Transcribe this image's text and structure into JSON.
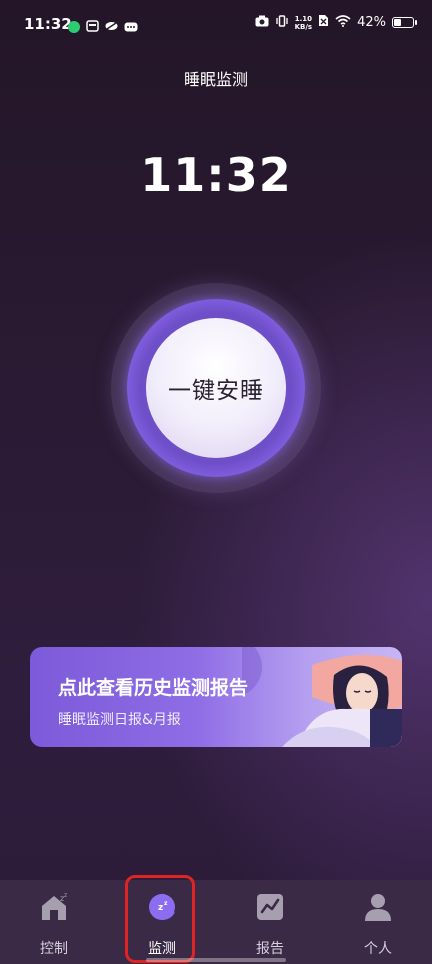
{
  "status_bar": {
    "time": "11:32",
    "network_speed_value": "1.10",
    "network_speed_unit": "KB/s",
    "battery": "42%",
    "battery_level": 0.42
  },
  "header": {
    "title": "睡眠监测"
  },
  "clock": {
    "time": "11:32"
  },
  "sleep_button": {
    "label": "一键安睡"
  },
  "history_card": {
    "title": "点此查看历史监测报告",
    "subtitle": "睡眠监测日报&月报"
  },
  "bottom_nav": {
    "items": [
      {
        "label": "控制",
        "icon": "home-sleep-icon"
      },
      {
        "label": "监测",
        "icon": "moon-icon",
        "active": true
      },
      {
        "label": "报告",
        "icon": "chart-icon"
      },
      {
        "label": "个人",
        "icon": "person-icon"
      }
    ]
  },
  "colors": {
    "accent_purple": "#8a66ee",
    "card_start": "#7c5ad9",
    "highlight": "#e02424"
  }
}
